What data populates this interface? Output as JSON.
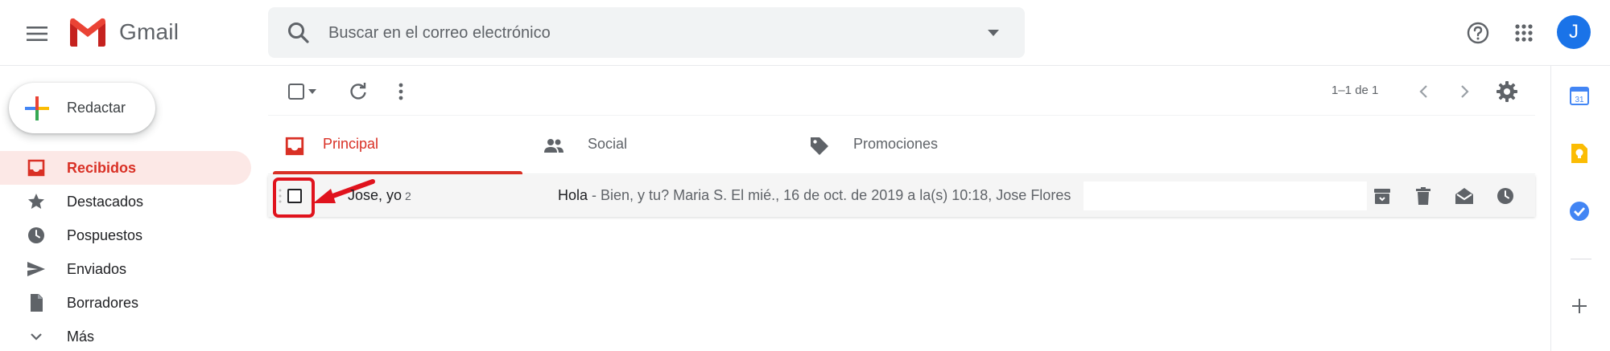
{
  "app": {
    "name": "Gmail"
  },
  "colors": {
    "accent_red": "#d93025",
    "avatar_blue": "#1a73e8",
    "highlight": "#e0131d"
  },
  "header": {
    "search_placeholder": "Buscar en el correo electrónico",
    "avatar_initial": "J"
  },
  "sidebar": {
    "compose_label": "Redactar",
    "items": [
      {
        "label": "Recibidos",
        "icon": "inbox-icon",
        "active": true
      },
      {
        "label": "Destacados",
        "icon": "star-icon"
      },
      {
        "label": "Pospuestos",
        "icon": "clock-icon"
      },
      {
        "label": "Enviados",
        "icon": "send-icon"
      },
      {
        "label": "Borradores",
        "icon": "draft-icon"
      },
      {
        "label": "Más",
        "icon": "chevron-down-icon"
      }
    ]
  },
  "toolbar": {
    "pager": "1–1 de 1"
  },
  "tabs": [
    {
      "label": "Principal",
      "icon": "inbox-icon",
      "active": true
    },
    {
      "label": "Social",
      "icon": "people-icon"
    },
    {
      "label": "Promociones",
      "icon": "tag-icon"
    }
  ],
  "messages": [
    {
      "sender": "Jose, yo",
      "count": "2",
      "subject": "Hola",
      "snippet": " - Bien, y tu? Maria S. El mié., 16 de oct. de 2019 a la(s) 10:18, Jose Flores"
    }
  ]
}
